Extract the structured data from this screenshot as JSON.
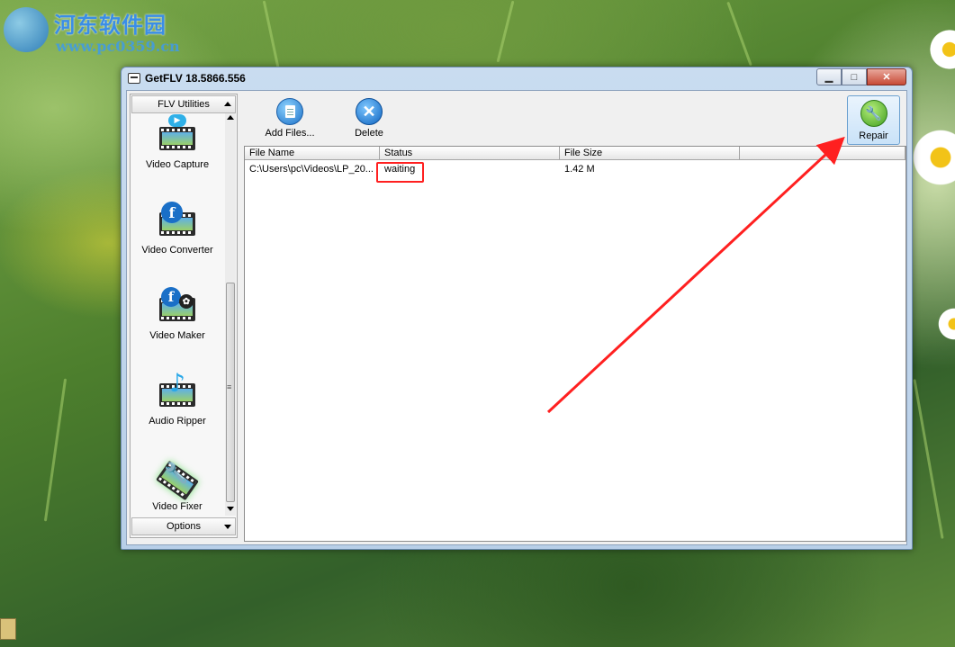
{
  "watermark": {
    "site_name": "河东软件园",
    "url": "www.pc0359.cn"
  },
  "window": {
    "title": "GetFLV 18.5866.556"
  },
  "sidebar": {
    "top_header": "FLV Utilities",
    "bottom_header": "Options",
    "items": [
      {
        "label": "Video Capture"
      },
      {
        "label": "Video Converter"
      },
      {
        "label": "Video Maker"
      },
      {
        "label": "Audio Ripper"
      },
      {
        "label": "Video Fixer",
        "selected": true
      }
    ]
  },
  "toolbar": {
    "add_files_label": "Add Files...",
    "delete_label": "Delete",
    "repair_label": "Repair"
  },
  "file_list": {
    "columns": [
      "File Name",
      "Status",
      "File Size",
      ""
    ],
    "rows": [
      {
        "file_name": "C:\\Users\\pc\\Videos\\LP_20...",
        "status": "waiting",
        "file_size": "1.42 M"
      }
    ]
  },
  "colors": {
    "annotation": "#ff2020",
    "accent": "#1a6fc7"
  }
}
